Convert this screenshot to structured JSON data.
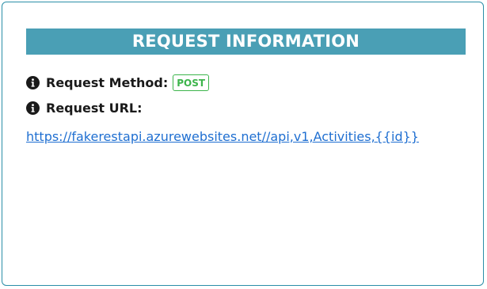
{
  "header": {
    "title": "REQUEST INFORMATION"
  },
  "request": {
    "method_label": "Request Method:",
    "method_value": "POST",
    "url_label": "Request URL:",
    "url_value": "https://fakerestapi.azurewebsites.net//api,v1,Activities,{{id}}"
  },
  "colors": {
    "header_bg": "#4a9fb5",
    "border": "#2b8fa8",
    "method_badge": "#3cb44b",
    "link": "#1f6fd1"
  },
  "icons": {
    "method_icon": "info-circle-icon",
    "url_icon": "info-circle-icon"
  }
}
